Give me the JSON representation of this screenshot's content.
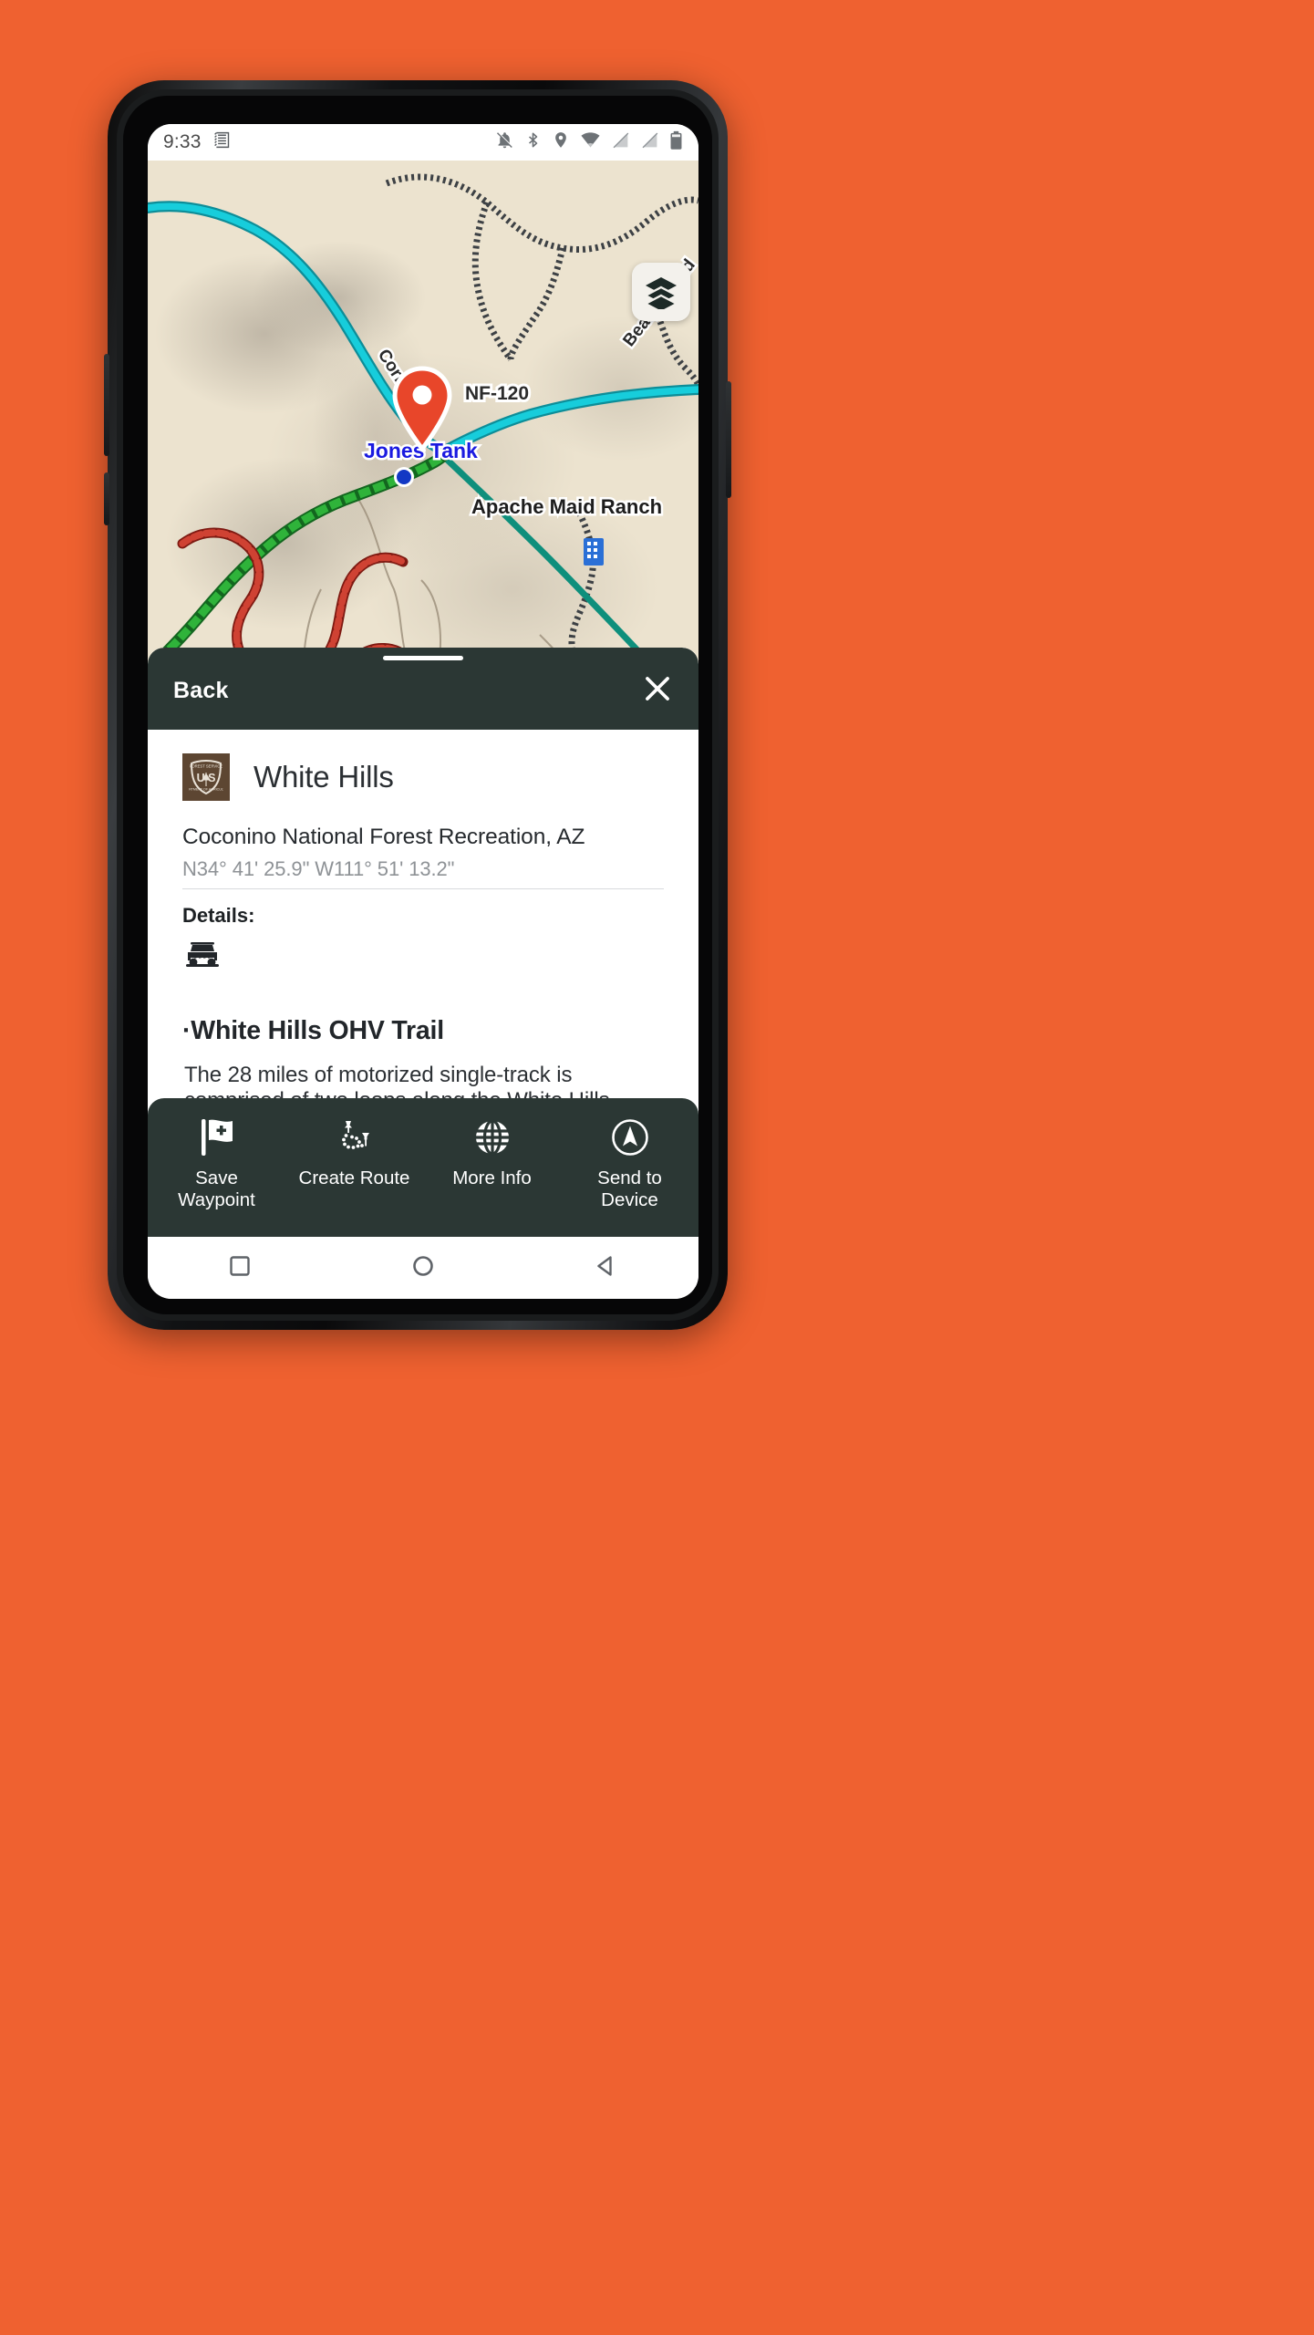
{
  "theme": {
    "page_background": "#ef6130",
    "sheet_dark": "#2b3734",
    "forest_badge_brown": "#5d4632",
    "map_base": "#ece3cf",
    "highway_cyan": "#17cddb",
    "trail_green": "#2ca02c",
    "trail_red": "#c23b2b",
    "pin_orange": "#e8462a",
    "label_blue": "#1a1ae0",
    "gps_dot_blue": "#1338c4"
  },
  "statusbar": {
    "time": "9:33",
    "left_icons": [
      "receipt-icon"
    ],
    "right_icons": [
      "bell-off-icon",
      "bluetooth-icon",
      "location-icon",
      "wifi-icon",
      "signal-off-icon",
      "signal-off-2-icon",
      "battery-icon"
    ]
  },
  "map": {
    "layers_button_label": "layers-icon",
    "labels": [
      {
        "text": "Cornville",
        "type": "road"
      },
      {
        "text": "NF-120",
        "type": "road"
      },
      {
        "text": "Beaver Head",
        "type": "road"
      },
      {
        "text": "Jones Tank",
        "type": "place"
      },
      {
        "text": "Apache Maid Ranch",
        "type": "place"
      }
    ],
    "selected_marker": "map-pin-marker",
    "current_location": "gps-position-dot"
  },
  "sheet": {
    "back_label": "Back",
    "close_label": "close-icon",
    "poi": {
      "title": "White Hills",
      "agency_badge": "us-forest-service-shield",
      "subtitle": "Coconino National Forest Recreation, AZ",
      "coordinates": "N34° 41' 25.9\" W111° 51' 13.2\"",
      "details_label": "Details:",
      "detail_icons": [
        "ohv-vehicle-icon"
      ],
      "trail_heading": "·White Hills OHV Trail",
      "trail_description": "The 28 miles of motorized single-track is comprised of two loops along the White Hills above the Verde River."
    }
  },
  "actionbar": {
    "items": [
      {
        "label": "Save\nWaypoint",
        "line1": "Save",
        "line2": "Waypoint",
        "icon": "flag-add-icon"
      },
      {
        "label": "Create Route",
        "line1": "Create Route",
        "line2": "",
        "icon": "route-pins-icon"
      },
      {
        "label": "More Info",
        "line1": "More Info",
        "line2": "",
        "icon": "globe-icon"
      },
      {
        "label": "Send to\nDevice",
        "line1": "Send to",
        "line2": "Device",
        "icon": "navigation-arrow-icon"
      }
    ]
  },
  "navbar": {
    "items": [
      {
        "name": "recents-button",
        "icon": "square-icon"
      },
      {
        "name": "home-button",
        "icon": "circle-icon"
      },
      {
        "name": "back-button",
        "icon": "triangle-back-icon"
      }
    ]
  }
}
